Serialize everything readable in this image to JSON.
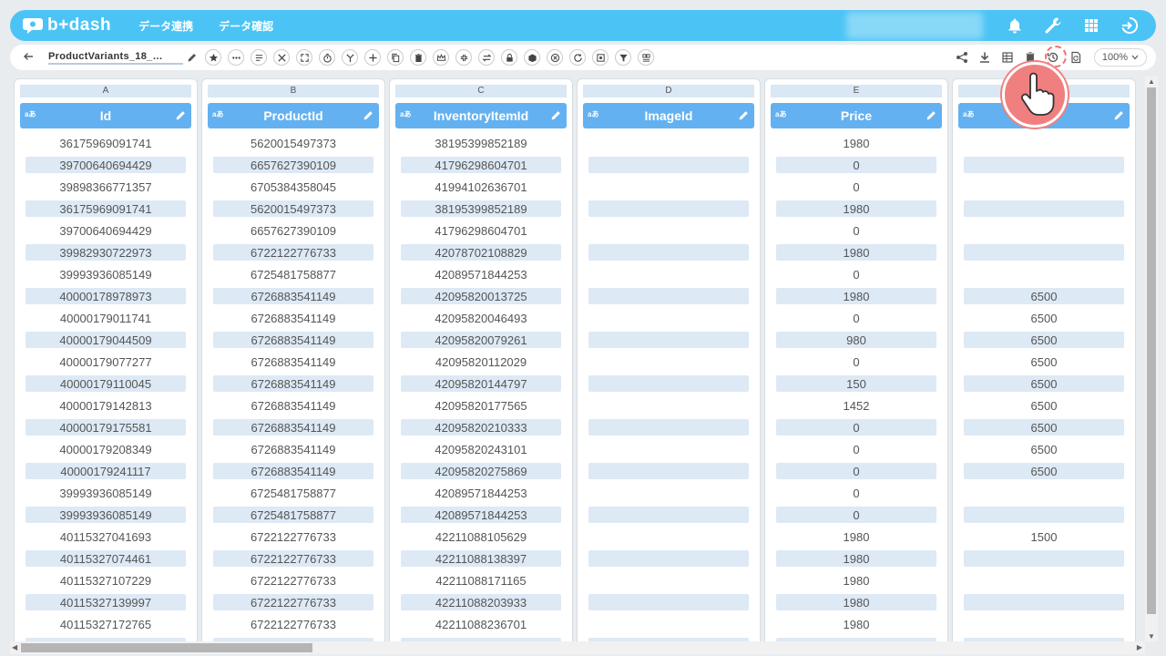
{
  "app": {
    "brand": "b+dash"
  },
  "header": {
    "nav": [
      "データ連携",
      "データ確認"
    ]
  },
  "toolbar": {
    "file_name": "ProductVariants_18_…",
    "zoom": "100%"
  },
  "colors": {
    "header": "#4bc4f5",
    "column_header": "#63b1f0",
    "row_band": "#dde9f5",
    "pointer": "#f08080"
  },
  "columns": [
    {
      "letter": "A",
      "type": "aあ",
      "title": "Id",
      "cells": [
        "36175969091741",
        "39700640694429",
        "39898366771357",
        "36175969091741",
        "39700640694429",
        "39982930722973",
        "39993936085149",
        "40000178978973",
        "40000179011741",
        "40000179044509",
        "40000179077277",
        "40000179110045",
        "40000179142813",
        "40000179175581",
        "40000179208349",
        "40000179241117",
        "39993936085149",
        "39993936085149",
        "40115327041693",
        "40115327074461",
        "40115327107229",
        "40115327139997",
        "40115327172765",
        ""
      ]
    },
    {
      "letter": "B",
      "type": "aあ",
      "title": "ProductId",
      "cells": [
        "5620015497373",
        "6657627390109",
        "6705384358045",
        "5620015497373",
        "6657627390109",
        "6722122776733",
        "6725481758877",
        "6726883541149",
        "6726883541149",
        "6726883541149",
        "6726883541149",
        "6726883541149",
        "6726883541149",
        "6726883541149",
        "6726883541149",
        "6726883541149",
        "6725481758877",
        "6725481758877",
        "6722122776733",
        "6722122776733",
        "6722122776733",
        "6722122776733",
        "6722122776733",
        ""
      ]
    },
    {
      "letter": "C",
      "type": "aあ",
      "title": "InventoryItemId",
      "cells": [
        "38195399852189",
        "41796298604701",
        "41994102636701",
        "38195399852189",
        "41796298604701",
        "42078702108829",
        "42089571844253",
        "42095820013725",
        "42095820046493",
        "42095820079261",
        "42095820112029",
        "42095820144797",
        "42095820177565",
        "42095820210333",
        "42095820243101",
        "42095820275869",
        "42089571844253",
        "42089571844253",
        "42211088105629",
        "42211088138397",
        "42211088171165",
        "42211088203933",
        "42211088236701",
        ""
      ]
    },
    {
      "letter": "D",
      "type": "aあ",
      "title": "ImageId",
      "cells": [
        "",
        "",
        "",
        "",
        "",
        "",
        "",
        "",
        "",
        "",
        "",
        "",
        "",
        "",
        "",
        "",
        "",
        "",
        "",
        "",
        "",
        "",
        "",
        ""
      ]
    },
    {
      "letter": "E",
      "type": "aあ",
      "title": "Price",
      "cells": [
        "1980",
        "0",
        "0",
        "1980",
        "0",
        "1980",
        "0",
        "1980",
        "0",
        "980",
        "0",
        "150",
        "1452",
        "0",
        "0",
        "0",
        "0",
        "0",
        "1980",
        "1980",
        "1980",
        "1980",
        "1980",
        ""
      ]
    },
    {
      "letter": "",
      "type": "aあ",
      "title": "rice",
      "cells": [
        "",
        "",
        "",
        "",
        "",
        "",
        "",
        "6500",
        "6500",
        "6500",
        "6500",
        "6500",
        "6500",
        "6500",
        "6500",
        "6500",
        "",
        "",
        "1500",
        "",
        "",
        "",
        "",
        ""
      ]
    }
  ]
}
